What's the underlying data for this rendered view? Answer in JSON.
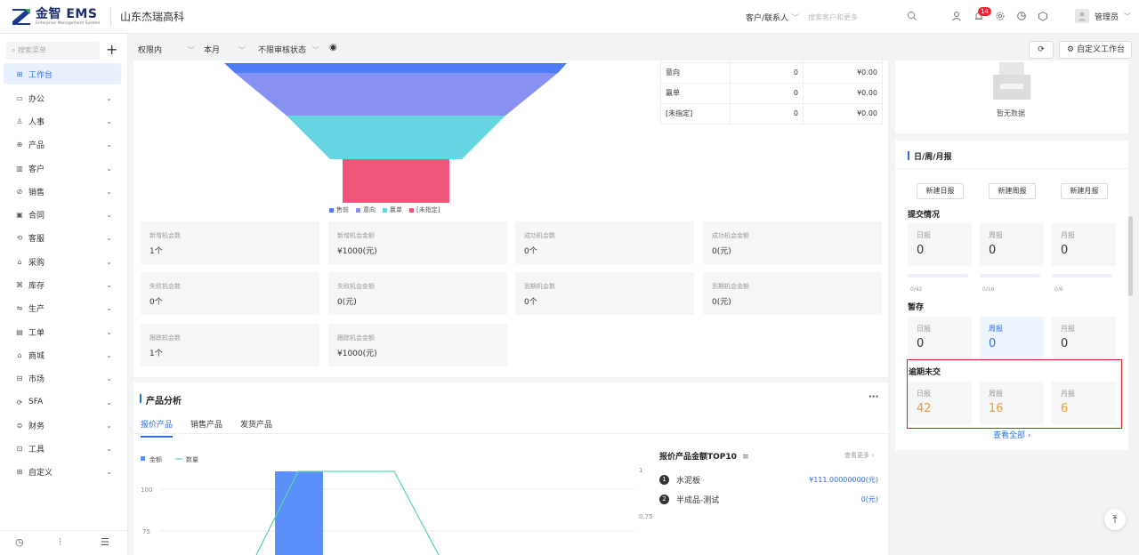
{
  "app": {
    "logo_main": "金智 EMS",
    "logo_sub": "Enterprise Management System",
    "company": "山东杰瑞高科"
  },
  "topbar": {
    "search_type": "客户/联系人",
    "search_placeholder": "搜索客户和更多",
    "notification_count": "14",
    "user_name": "管理员"
  },
  "sidebar": {
    "search_placeholder": "搜索菜单",
    "items": [
      {
        "icon": "⊞",
        "label": "工作台"
      },
      {
        "icon": "▭",
        "label": "办公"
      },
      {
        "icon": "♙",
        "label": "人事"
      },
      {
        "icon": "⊕",
        "label": "产品"
      },
      {
        "icon": "▥",
        "label": "客户"
      },
      {
        "icon": "⊘",
        "label": "销售"
      },
      {
        "icon": "▣",
        "label": "合同"
      },
      {
        "icon": "⟲",
        "label": "客服"
      },
      {
        "icon": "⌂",
        "label": "采购"
      },
      {
        "icon": "⌘",
        "label": "库存"
      },
      {
        "icon": "⇋",
        "label": "生产"
      },
      {
        "icon": "▤",
        "label": "工单"
      },
      {
        "icon": "⌂",
        "label": "商城"
      },
      {
        "icon": "⊟",
        "label": "市场"
      },
      {
        "icon": "⟳",
        "label": "SFA"
      },
      {
        "icon": "⊜",
        "label": "财务"
      },
      {
        "icon": "⊡",
        "label": "工具"
      },
      {
        "icon": "⊞",
        "label": "自定义"
      }
    ]
  },
  "filters": {
    "scope": "权限内",
    "period": "本月",
    "audit": "不限审核状态",
    "refresh_label": "",
    "custom_workbench": "自定义工作台"
  },
  "funnel": {
    "legend": [
      {
        "label": "售前",
        "color": "#4e7cf5"
      },
      {
        "label": "意向",
        "color": "#8590f0"
      },
      {
        "label": "赢单",
        "color": "#66d7e2"
      },
      {
        "label": "[未指定]",
        "color": "#f0557a"
      }
    ],
    "stages": [
      {
        "name": "售前",
        "color": "#4e7cf5"
      },
      {
        "name": "意向",
        "color": "#8590f0"
      },
      {
        "name": "赢单",
        "color": "#66d7e2"
      },
      {
        "name": "[未指定]",
        "color": "#f0557a"
      }
    ]
  },
  "stage_table": [
    {
      "stage": "意向",
      "count": "0",
      "amount": "¥0.00"
    },
    {
      "stage": "赢单",
      "count": "0",
      "amount": "¥0.00"
    },
    {
      "stage": "[未指定]",
      "count": "0",
      "amount": "¥0.00"
    }
  ],
  "kpis": [
    {
      "label": "新增机会数",
      "value": "1个"
    },
    {
      "label": "新增机会金额",
      "value": "¥1000(元)"
    },
    {
      "label": "成功机会数",
      "value": "0个"
    },
    {
      "label": "成功机会金额",
      "value": "0(元)"
    },
    {
      "label": "失败机会数",
      "value": "0个"
    },
    {
      "label": "失败机会金额",
      "value": "0(元)"
    },
    {
      "label": "到期机会数",
      "value": "0个"
    },
    {
      "label": "到期机会金额",
      "value": "0(元)"
    },
    {
      "label": "跟踪机会数",
      "value": "1个"
    },
    {
      "label": "跟踪机会金额",
      "value": "¥1000(元)"
    }
  ],
  "product_analysis": {
    "title": "产品分析",
    "more": "···",
    "tabs": [
      "报价产品",
      "销售产品",
      "发货产品"
    ],
    "active_tab": 0,
    "top10_title": "报价产品金额TOP10",
    "top10_more": "查看更多",
    "top10": [
      {
        "rank": "1",
        "name": "水泥板",
        "value": "¥111.00000000(元)"
      },
      {
        "rank": "2",
        "name": "半成品-测试",
        "value": "0(元)"
      }
    ]
  },
  "chart_data": {
    "type": "bar",
    "legend": [
      "金额",
      "数量"
    ],
    "series": [
      {
        "name": "金额",
        "type": "bar",
        "color": "#5b8ff9"
      },
      {
        "name": "数量",
        "type": "line",
        "color": "#5ad8a6"
      }
    ],
    "y_left_ticks": [
      "100",
      "75"
    ],
    "y_right_ticks": [
      "1",
      "0.75"
    ],
    "grid": true
  },
  "right_panel": {
    "empty_text": "暂无数据",
    "report_title": "日/周/月报",
    "buttons": [
      "新建日报",
      "新建周报",
      "新建月报"
    ],
    "submit_title": "提交情况",
    "submit": [
      {
        "label": "日报",
        "value": "0",
        "ratio": "0/42"
      },
      {
        "label": "周报",
        "value": "0",
        "ratio": "0/16"
      },
      {
        "label": "月报",
        "value": "0",
        "ratio": "0/6"
      }
    ],
    "draft_title": "暂存",
    "draft": [
      {
        "label": "日报",
        "value": "0"
      },
      {
        "label": "周报",
        "value": "0"
      },
      {
        "label": "月报",
        "value": "0"
      }
    ],
    "overdue_title": "逾期未交",
    "overdue": [
      {
        "label": "日报",
        "value": "42"
      },
      {
        "label": "周报",
        "value": "16"
      },
      {
        "label": "月报",
        "value": "6"
      }
    ],
    "see_all": "查看全部 ›"
  }
}
